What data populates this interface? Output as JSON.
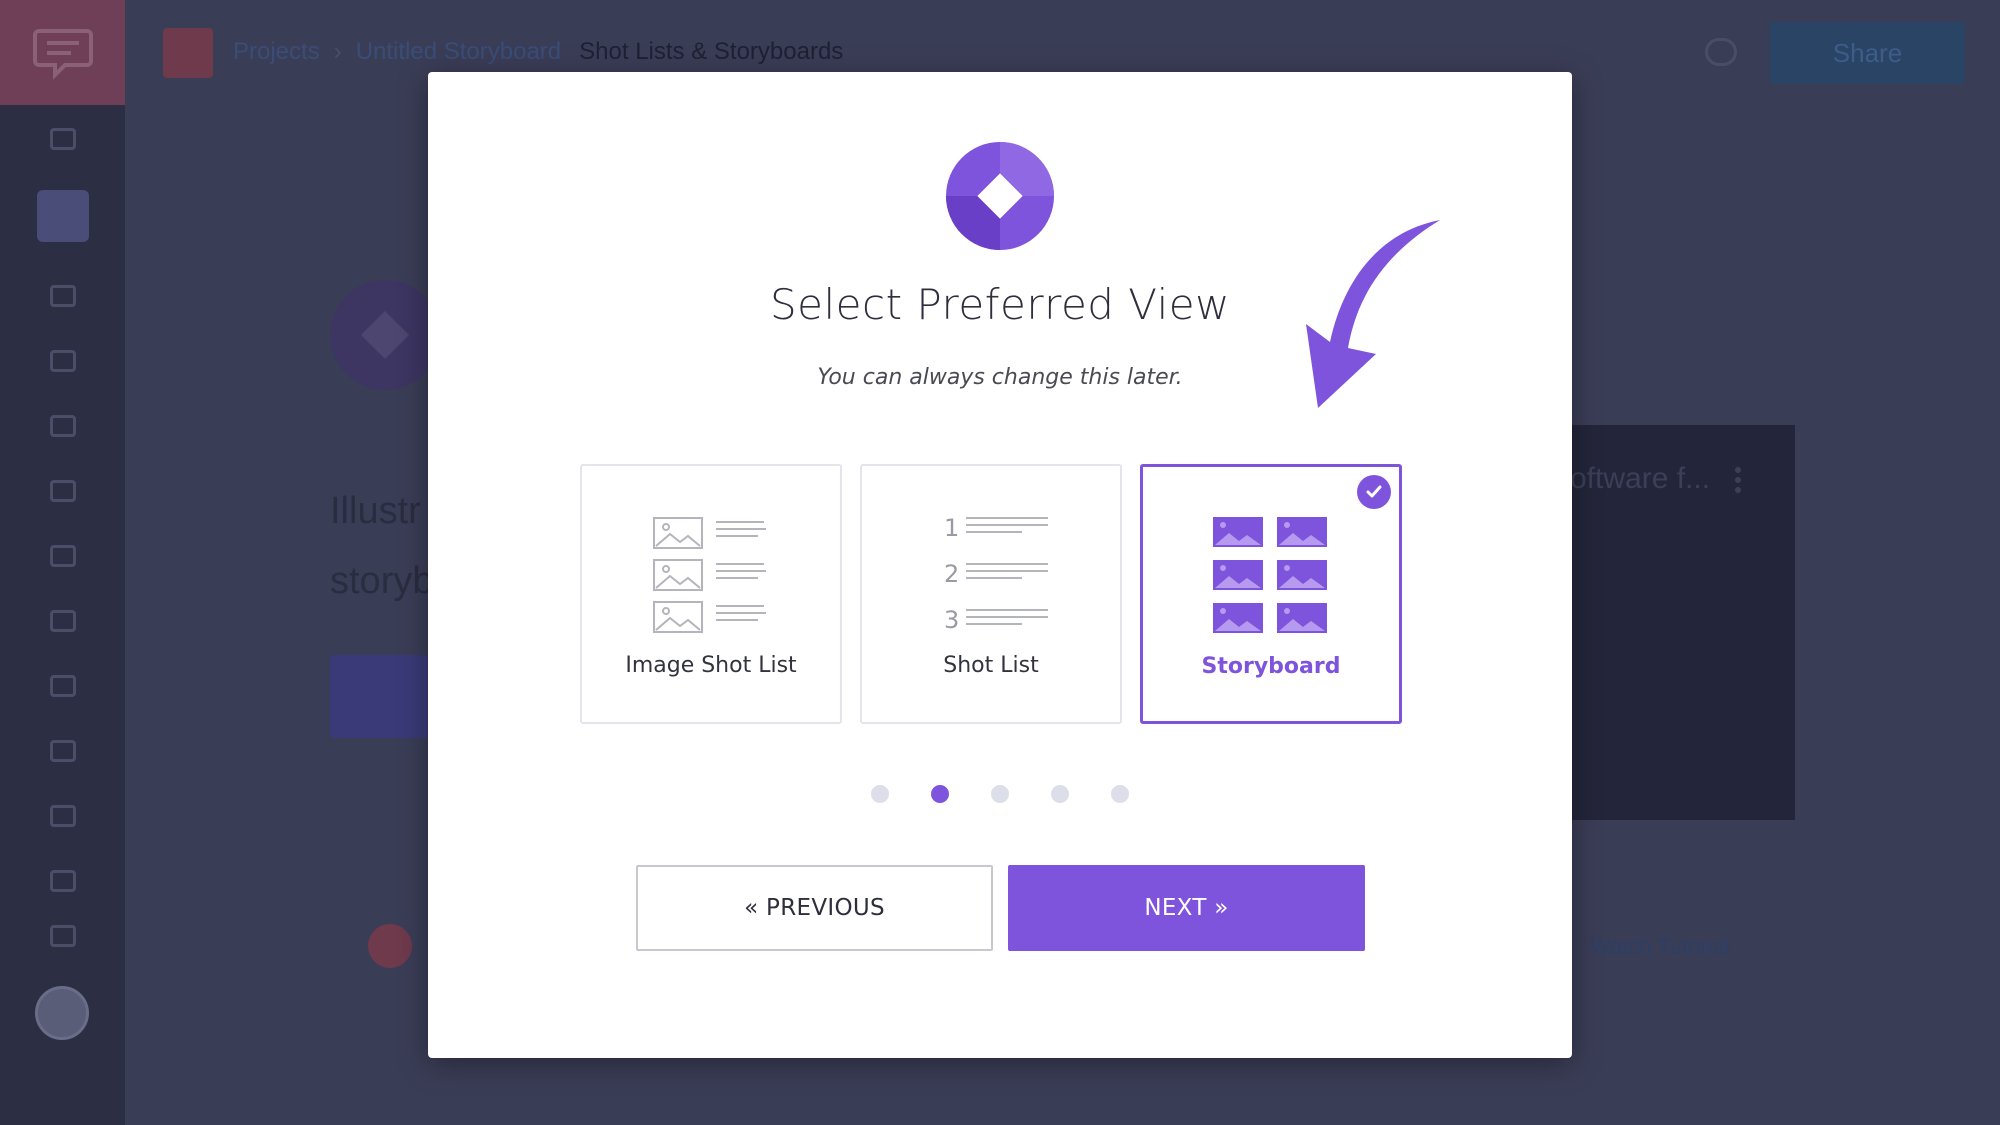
{
  "app": {
    "breadcrumb": {
      "root": "Projects",
      "middle": "Untitled Storyboard",
      "current": "Shot Lists & Storyboards"
    },
    "share_label": "Share",
    "bg_text_line1": "Illustr",
    "bg_text_line2": "storyb",
    "bg_card_title": "oftware f...",
    "bg_link": "Watch Tutorial"
  },
  "modal": {
    "title": "Select Preferred View",
    "subtitle": "You can always change this later.",
    "options": [
      {
        "label": "Image Shot List",
        "icon": "image-list-icon",
        "selected": false
      },
      {
        "label": "Shot List",
        "icon": "numbered-list-icon",
        "selected": false,
        "numbers": [
          "1",
          "2",
          "3"
        ]
      },
      {
        "label": "Storyboard",
        "icon": "storyboard-grid-icon",
        "selected": true
      }
    ],
    "pagination": {
      "total": 5,
      "current": 2
    },
    "prev_label": "« PREVIOUS",
    "next_label": "NEXT »"
  },
  "colors": {
    "accent": "#7f54dc",
    "overlay_bg": "#3a3d56",
    "sidebar": "#2c2e43"
  }
}
